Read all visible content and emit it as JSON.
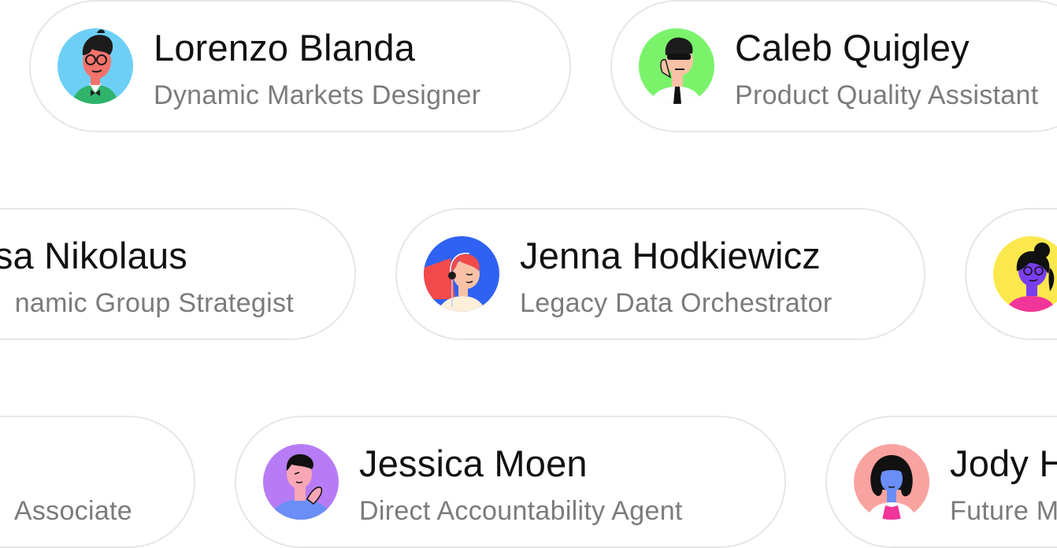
{
  "cards": [
    {
      "name": "Lorenzo Blanda",
      "role": "Dynamic Markets Designer",
      "avatar": "avatar-illustration-glasses-man"
    },
    {
      "name": "Caleb Quigley",
      "role": "Product Quality Assistant",
      "avatar": "avatar-illustration-sunglasses-man"
    },
    {
      "name": "sa Nikolaus",
      "role": "namic Group Strategist",
      "avatar": ""
    },
    {
      "name": "Jenna Hodkiewicz",
      "role": "Legacy Data Orchestrator",
      "avatar": "avatar-illustration-headset-woman"
    },
    {
      "name": "",
      "role": "",
      "avatar": "avatar-illustration-bun-woman"
    },
    {
      "name": "",
      "role": "Associate",
      "avatar": ""
    },
    {
      "name": "Jessica Moen",
      "role": "Direct Accountability Agent",
      "avatar": "avatar-illustration-thinking-man"
    },
    {
      "name": "Jody H",
      "role": "Future M",
      "avatar": "avatar-illustration-curly-woman"
    }
  ],
  "colors": {
    "card_border": "#e6e6e6",
    "name_text": "#111111",
    "role_text": "#7b7b7b",
    "avatar_bg_blue": "#6ecff6",
    "avatar_bg_green": "#7af36b",
    "avatar_bg_royal": "#2f62f2",
    "avatar_bg_yellow": "#fbe84d",
    "avatar_bg_purple": "#b77cf5",
    "avatar_bg_pink": "#f8a3a0"
  }
}
